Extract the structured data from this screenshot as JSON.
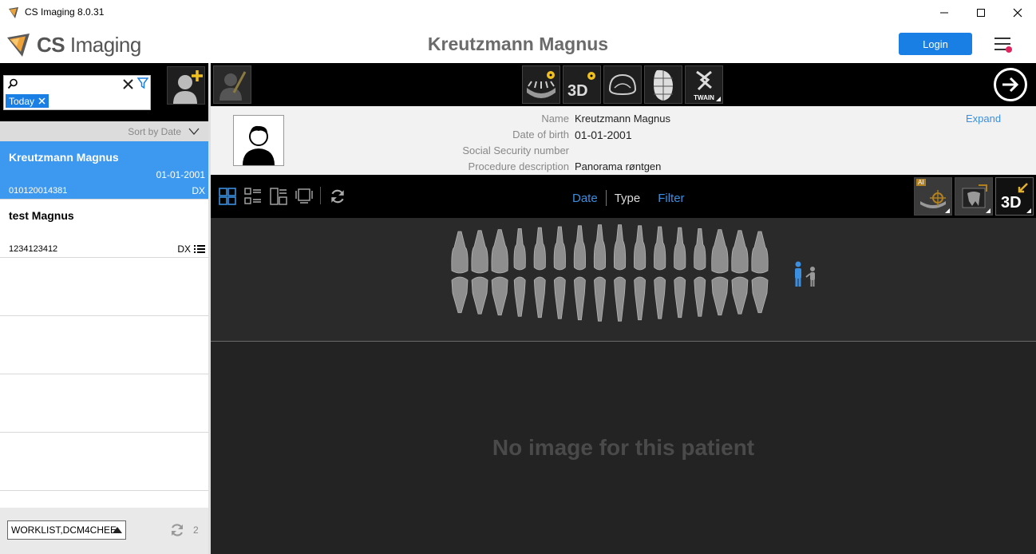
{
  "window": {
    "title": "CS Imaging 8.0.31",
    "controls": [
      "minimize",
      "maximize",
      "close"
    ]
  },
  "header": {
    "brand_bold": "CS",
    "brand_rest": " Imaging",
    "patient_title": "Kreutzmann Magnus",
    "login_label": "Login"
  },
  "search": {
    "value": "",
    "chip_label": "Today"
  },
  "sort": {
    "label": "Sort by Date"
  },
  "patients": [
    {
      "name": "Kreutzmann Magnus",
      "date": "01-01-2001",
      "id": "010120014381",
      "modality": "DX",
      "selected": true
    },
    {
      "name": "test Magnus",
      "date": "",
      "id": "1234123412",
      "modality": "DX",
      "selected": false
    }
  ],
  "footer": {
    "worklist": "WORKLIST,DCM4CHEE",
    "count": "2"
  },
  "acquisition_tools": [
    {
      "name": "panoramic-xray",
      "label": ""
    },
    {
      "name": "3d-xray",
      "label": "3D"
    },
    {
      "name": "intraoral-scan",
      "label": ""
    },
    {
      "name": "face-scan",
      "label": ""
    },
    {
      "name": "twain",
      "label": "TWAIN"
    }
  ],
  "info": {
    "fields": [
      {
        "key": "Name",
        "value": "Kreutzmann Magnus"
      },
      {
        "key": "Date of birth",
        "value": "01-01-2001"
      },
      {
        "key": "Social Security number",
        "value": ""
      },
      {
        "key": "Procedure description",
        "value": "Panorama røntgen"
      }
    ],
    "expand_label": "Expand"
  },
  "view_tabs": {
    "date": "Date",
    "type": "Type",
    "filter": "Filter"
  },
  "right_tools": {
    "ai_badge": "AI",
    "three_d": "3D"
  },
  "empty_message": "No image for this patient",
  "colors": {
    "accent": "#1a7fe5",
    "selected_row": "#3d98f0",
    "tab_active": "#3a8fe0"
  }
}
